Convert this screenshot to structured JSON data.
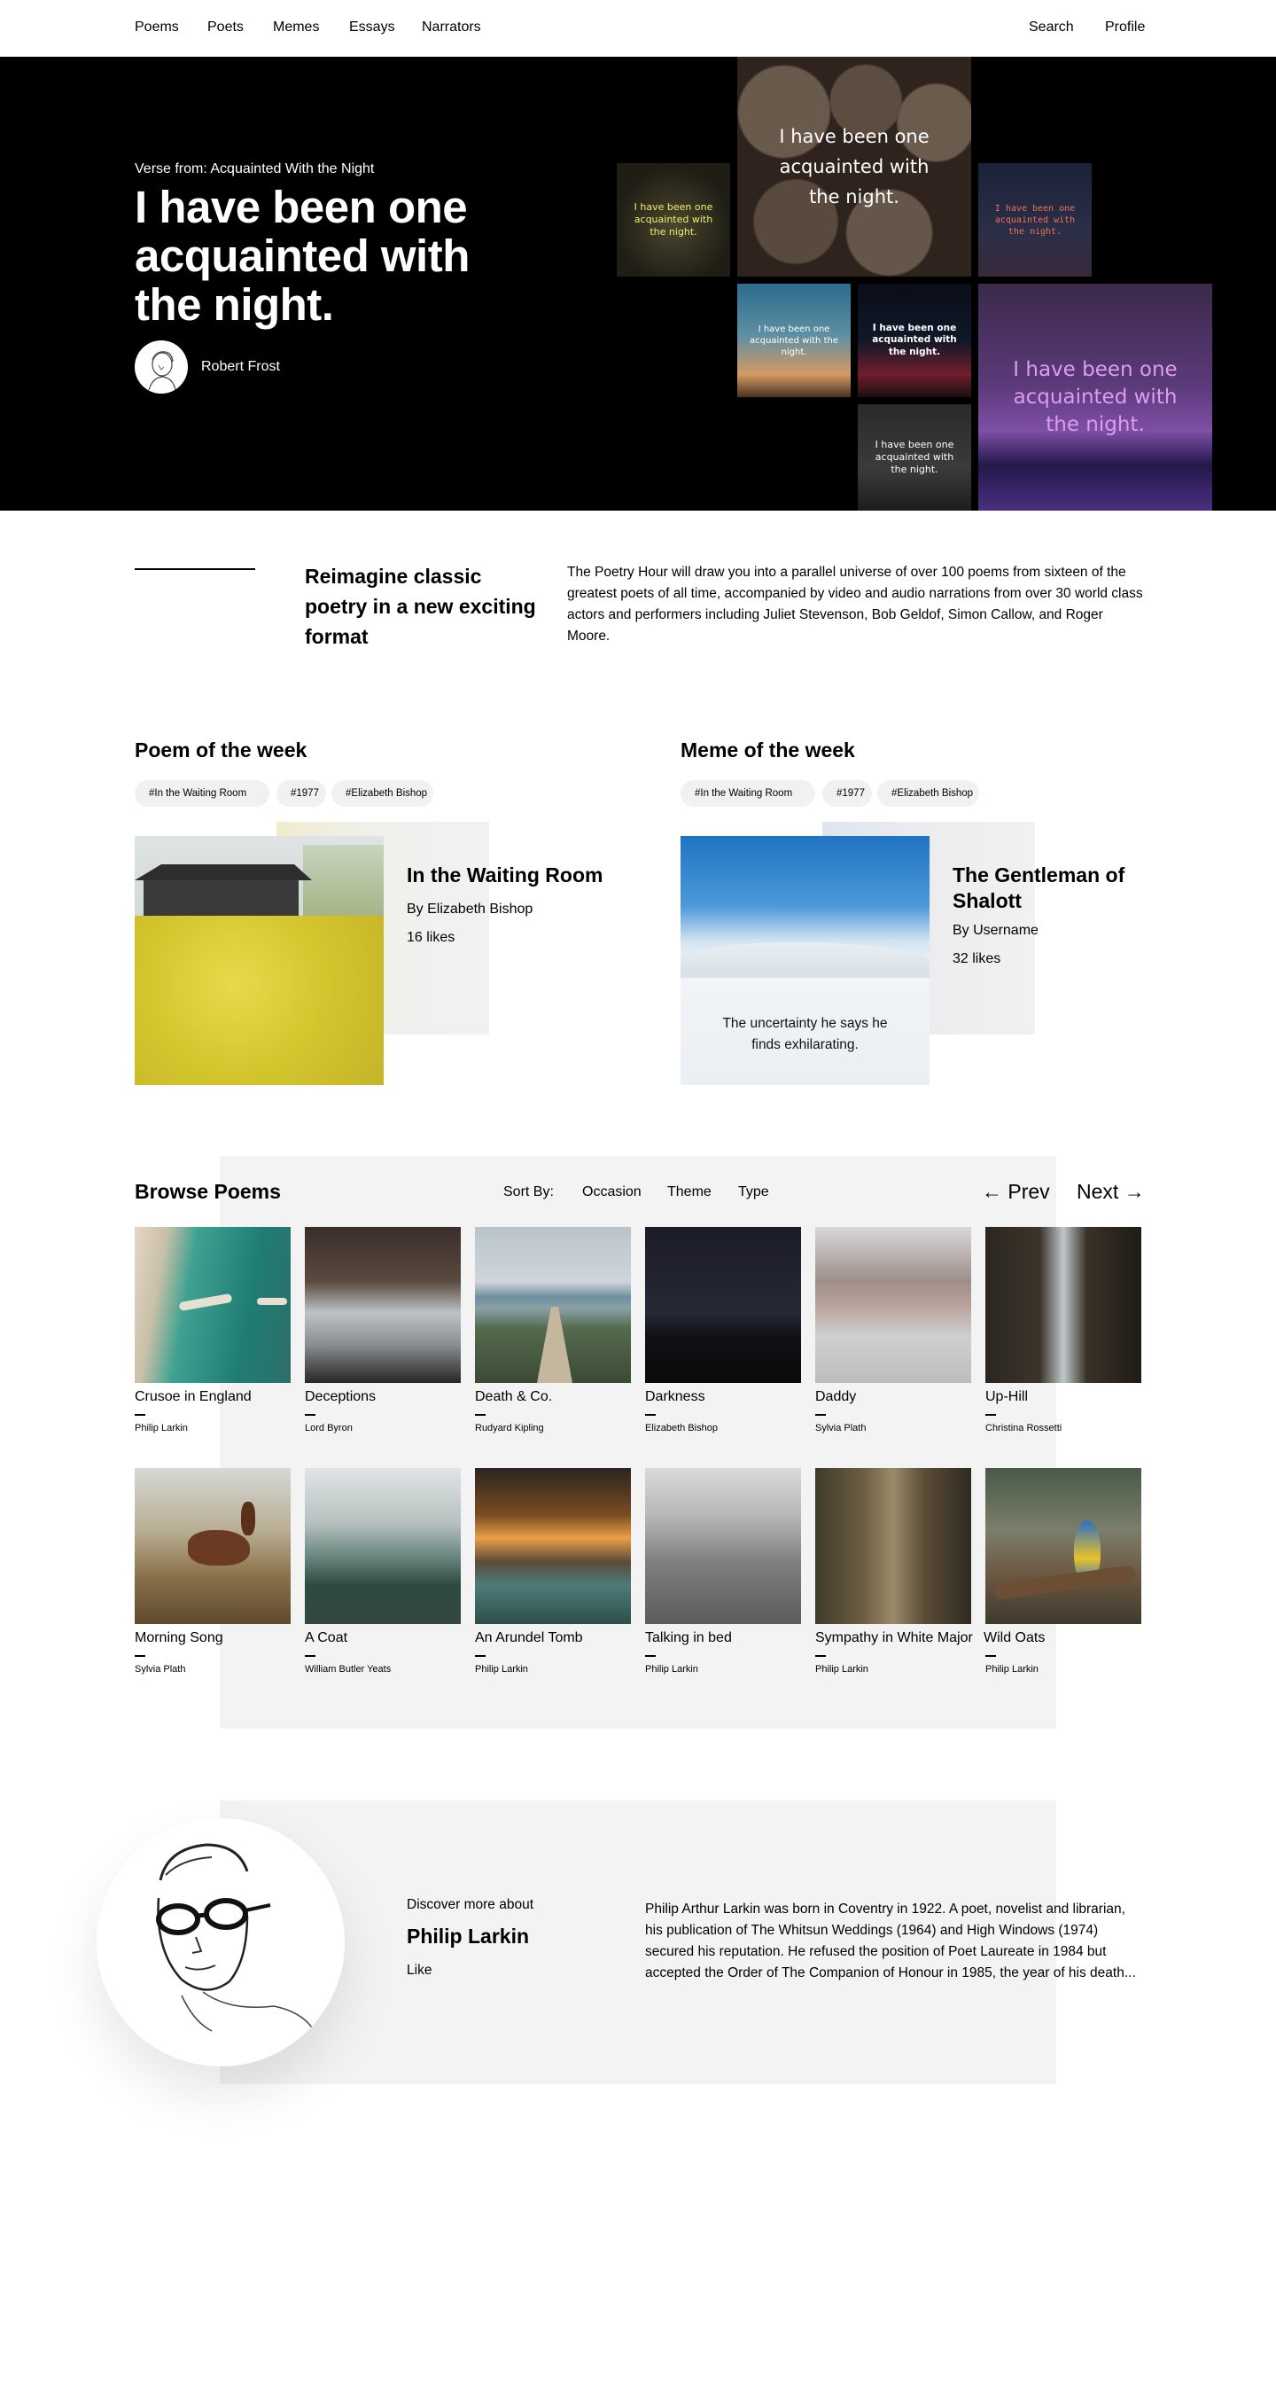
{
  "nav": {
    "left": [
      "Poems",
      "Poets",
      "Memes",
      "Essays",
      "Narrators"
    ],
    "search": "Search",
    "profile": "Profile"
  },
  "hero": {
    "kicker": "Verse from: Acquainted With the Night",
    "headline": "I have been one acquainted with the night.",
    "author": "Robert Frost",
    "tile_text": "I have been one acquainted with the night."
  },
  "intro": {
    "title": "Reimagine classic poetry in a new exciting format",
    "body": "The Poetry Hour will draw you into a parallel universe of over 100 poems from sixteen of the greatest poets of all time, accompanied by video and audio narrations from over 30 world class actors and performers including Juliet Stevenson, Bob Geldof, Simon Callow, and Roger Moore."
  },
  "poem_of_week": {
    "heading": "Poem of the week",
    "tags": [
      "#In the Waiting Room",
      "#1977",
      "#Elizabeth Bishop"
    ],
    "title": "In the Waiting Room",
    "author": "By Elizabeth Bishop",
    "likes": "16 likes"
  },
  "meme_of_week": {
    "heading": "Meme of the week",
    "tags": [
      "#In the Waiting Room",
      "#1977",
      "#Elizabeth Bishop"
    ],
    "title": "The Gentleman of Shalott",
    "author": "By Username",
    "likes": "32 likes",
    "caption": "The uncertainty he says he finds exhilarating."
  },
  "browse": {
    "title": "Browse Poems",
    "sort_label": "Sort By:",
    "sort_options": [
      "Occasion",
      "Theme",
      "Type"
    ],
    "prev": "Prev",
    "next": "Next",
    "poems": [
      {
        "title": "Crusoe in England",
        "author": "Philip Larkin"
      },
      {
        "title": "Deceptions",
        "author": "Lord Byron"
      },
      {
        "title": "Death & Co.",
        "author": "Rudyard Kipling"
      },
      {
        "title": "Darkness",
        "author": "Elizabeth Bishop"
      },
      {
        "title": "Daddy",
        "author": "Sylvia Plath"
      },
      {
        "title": "Up-Hill",
        "author": "Christina Rossetti"
      },
      {
        "title": "Morning Song",
        "author": "Sylvia Plath"
      },
      {
        "title": "A Coat",
        "author": "William Butler Yeats"
      },
      {
        "title": "An Arundel Tomb",
        "author": "Philip Larkin"
      },
      {
        "title": "Talking in bed",
        "author": "Philip Larkin"
      },
      {
        "title": "Sympathy in White Major",
        "author": "Philip Larkin"
      },
      {
        "title": "Wild Oats",
        "author": "Philip Larkin"
      }
    ]
  },
  "poet": {
    "kicker": "Discover more about",
    "name": "Philip Larkin",
    "like": "Like",
    "bio": "Philip Arthur Larkin was born in Coventry in 1922. A poet, novelist and librarian, his publication of The Whitsun Weddings (1964) and High Windows (1974) secured his reputation. He refused the position of Poet Laureate in 1984 but accepted the Order of The Companion of Honour in 1985, the year of his death..."
  }
}
